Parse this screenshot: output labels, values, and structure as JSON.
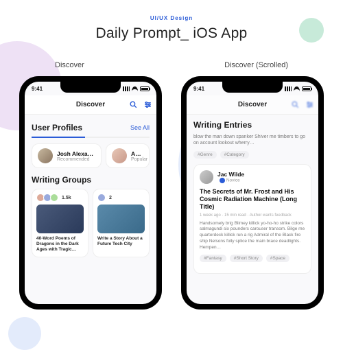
{
  "page": {
    "eyebrow": "UI/UX Design",
    "title": "Daily Prompt_ iOS App"
  },
  "labels": {
    "left": "Discover",
    "right": "Discover (Scrolled)"
  },
  "status": {
    "time": "9:41"
  },
  "navbar": {
    "title": "Discover"
  },
  "left_phone": {
    "section_profiles": {
      "title": "User Profiles",
      "see_all": "See All",
      "items": [
        {
          "name": "Josh Alexander",
          "subtitle": "Recommended",
          "verified": true
        },
        {
          "name": "Anna Smi",
          "subtitle": "Popular",
          "verified": false
        }
      ]
    },
    "section_groups": {
      "title": "Writing Groups",
      "items": [
        {
          "count": "1.5k",
          "title": "40-Word Poems of Dragons in the Dark Ages with Tragic…"
        },
        {
          "count": "2",
          "title": "Write a Story About a Future Tech City"
        }
      ]
    }
  },
  "right_phone": {
    "section_entries": {
      "title": "Writing Entries",
      "prev_excerpt": "blow the man down spanker Shiver me timbers to go on account lookout wherry…",
      "prev_tags": [
        "#Genre",
        "#Category"
      ],
      "entry": {
        "author": "Jac Wilde",
        "rank": "Novice",
        "title": "The Secrets of Mr. Frost and His Cosmic Radiation Machine (Long Title)",
        "meta": "1 week ago · 15 min read · Author wants feedback",
        "body": "Handsomely brig Blimey killick yo-ho-ho strike colors salmagundi six pounders carouser transom. Bilge me quarterdeck killick run a rig Admiral of the Black fire ship Nelsons folly splice the main brace deadlights. Hempen…",
        "tags": [
          "#Fantasy",
          "#Short Story",
          "#Space"
        ]
      }
    }
  }
}
